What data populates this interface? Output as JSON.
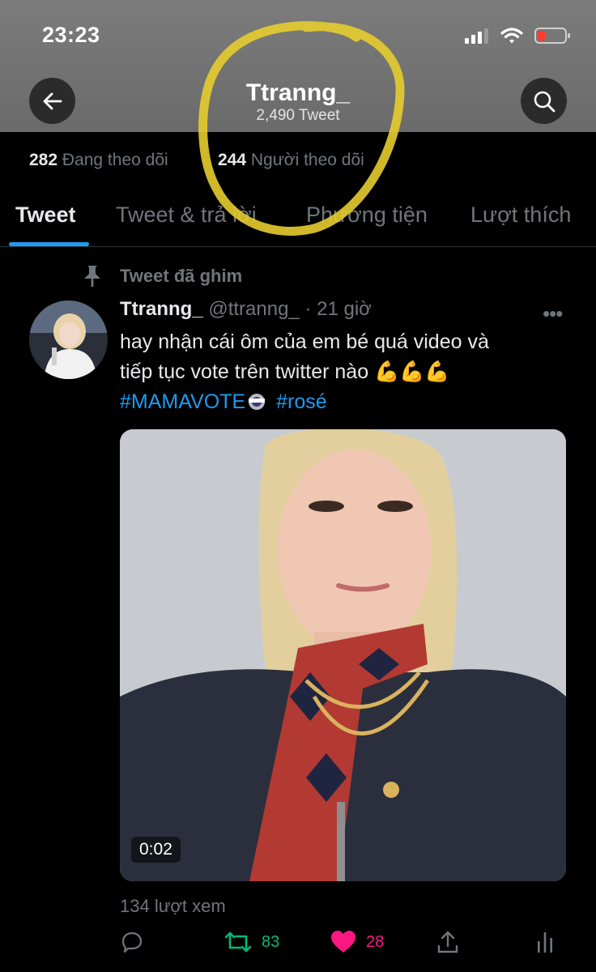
{
  "status_bar": {
    "time": "23:23"
  },
  "header": {
    "title": "Ttranng_",
    "subtitle": "2,490 Tweet"
  },
  "follow": {
    "following_count": "282",
    "following_label": "Đang theo dõi",
    "followers_count": "244",
    "followers_label": "Người theo dõi"
  },
  "tabs": [
    {
      "label": "Tweet",
      "active": true
    },
    {
      "label": "Tweet & trả lời"
    },
    {
      "label": "Phương tiện"
    },
    {
      "label": "Lượt thích"
    }
  ],
  "pinned_label": "Tweet đã ghim",
  "tweet": {
    "name": "Ttranng_",
    "handle": "@ttranng_",
    "time": "· 21 giờ",
    "text_line1": "hay nhận cái ôm của em bé quá video và",
    "text_line2": "tiếp tục vote trên twitter nào 💪💪💪",
    "hashtag1": "#MAMAVOTE",
    "hashtag2": "#rosé",
    "video_duration": "0:02",
    "views": "134 lượt xem",
    "retweets": "83",
    "likes": "28"
  },
  "colors": {
    "accent": "#1d9bf0",
    "retweet": "#00ba7c",
    "like": "#f91880",
    "highlight": "#e6cc2e"
  },
  "icons": [
    "back-arrow-icon",
    "search-icon",
    "pin-icon",
    "more-icon",
    "reply-icon",
    "retweet-icon",
    "heart-icon",
    "share-icon",
    "analytics-icon",
    "signal-icon",
    "wifi-icon",
    "battery-icon"
  ]
}
